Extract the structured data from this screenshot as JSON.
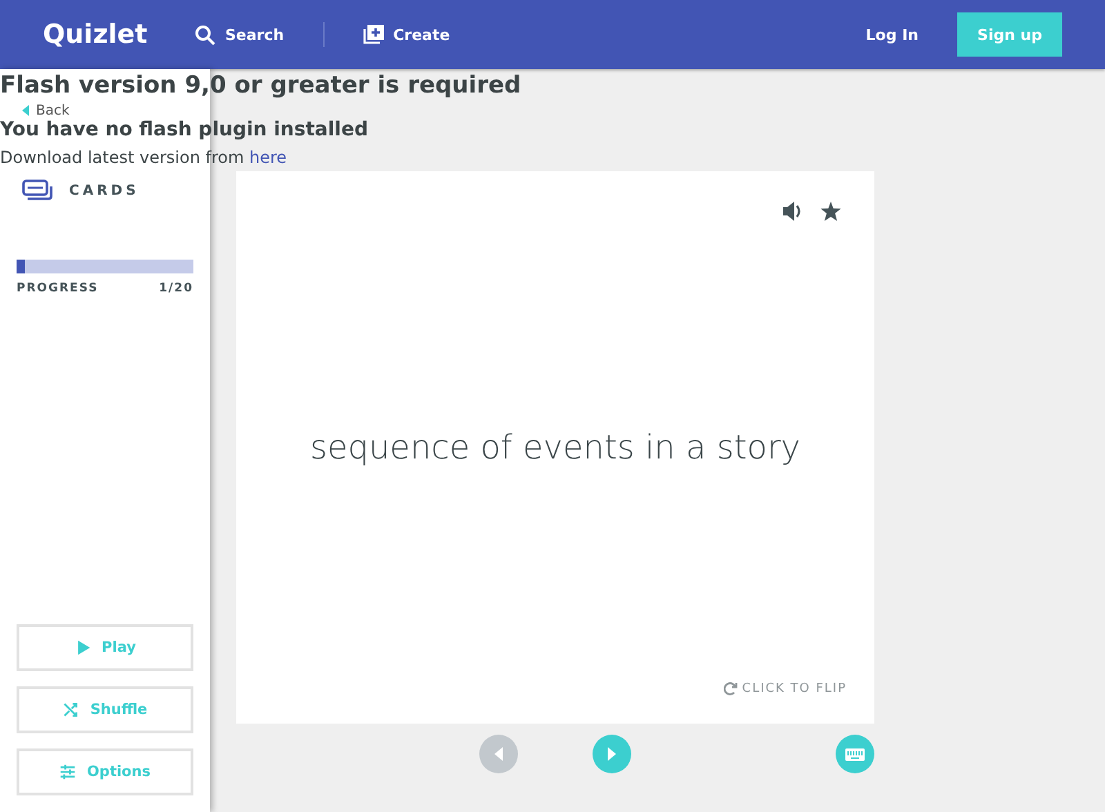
{
  "header": {
    "logo": "Quizlet",
    "search": "Search",
    "create": "Create",
    "login": "Log In",
    "signup": "Sign up"
  },
  "flash_notice": {
    "title": "Flash version 9,0 or greater is required",
    "subtitle": "You have no flash plugin installed",
    "download_text": "Download latest version from ",
    "download_link": "here"
  },
  "sidebar": {
    "back": "Back",
    "mode": "CARDS",
    "progress": {
      "label": "PROGRESS",
      "count": "1/20",
      "level": 0.05
    },
    "buttons": [
      {
        "kind": "play",
        "label": "Play"
      },
      {
        "kind": "shuffle",
        "label": "Shuffle"
      },
      {
        "kind": "options",
        "label": "Options"
      }
    ]
  },
  "card": {
    "term": "sequence of events in a story",
    "starred": false,
    "flip_hint": "CLICK TO FLIP"
  },
  "nav": {
    "prev_disabled": true,
    "next_disabled": false
  }
}
